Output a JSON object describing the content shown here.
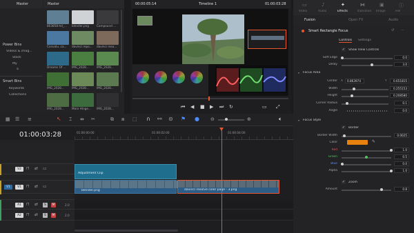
{
  "media_pool": {
    "title": "Master",
    "header": "Master",
    "power_bins_label": "Power Bins",
    "power_bins": [
      "Videos & imag...",
      "Stock",
      "My",
      "a"
    ],
    "smart_bins_label": "Smart Bins",
    "smart_bins": [
      "Keywords",
      "Collections"
    ],
    "clips": [
      {
        "label": "803858-hd_...",
        "color": "#5f7f95"
      },
      {
        "label": "blender.png",
        "color": "#cfd3d6"
      },
      {
        "label": "Compound ...",
        "color": "#3a3a3c"
      },
      {
        "label": "Convolu..ca...",
        "color": "#4a78a0"
      },
      {
        "label": "davinci repo...",
        "color": "#6e8a62"
      },
      {
        "label": "davinci reso...",
        "color": "#7e6a5a"
      },
      {
        "label": "Dreams Of ...",
        "color": "#2d6a8a"
      },
      {
        "label": "IMG_2028...",
        "color": "#4b7f42"
      },
      {
        "label": "IMG_2028...",
        "color": "#5a8a50"
      },
      {
        "label": "IMG_2028...",
        "color": "#3f6f35"
      },
      {
        "label": "IMG_2028...",
        "color": "#6b8a58"
      },
      {
        "label": "IMG_2028...",
        "color": "#5c7a4f"
      },
      {
        "label": "IMG_2028...",
        "color": "#4e6c44"
      },
      {
        "label": "Moro Hinge...",
        "color": "#3c6b3d"
      },
      {
        "label": "IMG_2028...",
        "color": "#2f2f31"
      }
    ]
  },
  "viewer": {
    "timecode_left": "00:00:05:14",
    "timeline_name": "Timeline 1",
    "timecode_right": "01:00:03:28"
  },
  "inspector": {
    "tabs": [
      "Video",
      "Audio",
      "Effects",
      "Transition",
      "Image",
      "File"
    ],
    "active_tab": "Effects",
    "subtabs": [
      "Fusion",
      "Open FX",
      "Audio"
    ],
    "effect_name": "Smart Rectangle Focus",
    "controls_tabs": [
      "Controls",
      "Settings"
    ],
    "show_view_controls": "Show View Controls",
    "soft_edge_label": "Soft Edge",
    "soft_edge": "0.0",
    "delay_label": "Delay",
    "delay": "3.0",
    "focus_area": "Focus Area",
    "center_label": "Center",
    "center_x_label": "X",
    "center_x": "0.863974",
    "center_y_label": "Y",
    "center_y": "0.651815",
    "width_label": "Width",
    "width": "0.255153",
    "height_label": "Height",
    "height": "0.208580",
    "corner_label": "Corner Radius",
    "corner": "0.1",
    "angle_label": "Angle",
    "angle": "0.0",
    "focus_style": "Focus Style",
    "border_check": "Border",
    "border_width_label": "Border Width",
    "border_width": "0.0025",
    "color_label": "Color",
    "color_swatch": "#e8820e",
    "red_label": "Red",
    "red": "1.0",
    "green_label": "Green",
    "green": "0.5",
    "blue_label": "Blue",
    "blue": "0.0",
    "alpha_label": "Alpha",
    "alpha": "1.0",
    "zoom_check": "Zoom",
    "amount_label": "Amount",
    "amount": "0.8"
  },
  "timeline": {
    "timecode": "01:00:03:28",
    "ruler": [
      "01:00:00:00",
      "01:00:02:00",
      "01:00:04:00"
    ],
    "adjustment_clip": "Adjustment Clip",
    "clip1": "blender.png",
    "clip2": "davinci resolve color page - 3.png",
    "tracks": [
      {
        "name": "V2",
        "kind": "video"
      },
      {
        "name": "V1",
        "kind": "video"
      },
      {
        "name": "A1",
        "kind": "audio",
        "vol": "2.0"
      },
      {
        "name": "A2",
        "kind": "audio",
        "vol": "2.0"
      }
    ]
  },
  "accent": "#e8572e"
}
